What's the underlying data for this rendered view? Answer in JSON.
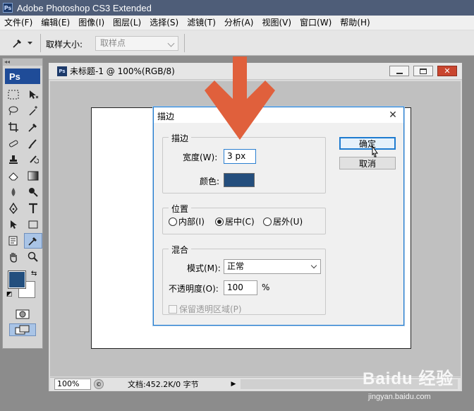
{
  "app": {
    "title": "Adobe Photoshop CS3 Extended",
    "badge": "Ps"
  },
  "menubar": {
    "items": [
      "文件(F)",
      "编辑(E)",
      "图像(I)",
      "图层(L)",
      "选择(S)",
      "滤镜(T)",
      "分析(A)",
      "视图(V)",
      "窗口(W)",
      "帮助(H)"
    ]
  },
  "options_bar": {
    "tool_icon": "eyedropper-icon",
    "sample_size_label": "取样大小:",
    "sample_size_value": "取样点"
  },
  "toolbox": {
    "logo": "Ps",
    "foreground_color": "#234f7e",
    "background_color": "#ffffff"
  },
  "document": {
    "title": "未标题-1 @ 100%(RGB/8)",
    "zoom": "100%",
    "status": "文档:452.2K/0 字节"
  },
  "dialog": {
    "title": "描边",
    "stroke_section": "描边",
    "width_label": "宽度(W):",
    "width_value": "3 px",
    "color_label": "颜色:",
    "stroke_color": "#244e7d",
    "position_section": "位置",
    "position_options": [
      "内部(I)",
      "居中(C)",
      "居外(U)"
    ],
    "position_selected": "居中(C)",
    "blend_section": "混合",
    "mode_label": "模式(M):",
    "mode_value": "正常",
    "opacity_label": "不透明度(O):",
    "opacity_value": "100",
    "opacity_unit": "%",
    "preserve_label": "保留透明区域(P)",
    "ok_label": "确定",
    "cancel_label": "取消"
  },
  "overlay": {
    "arrow_color": "#e0603c"
  },
  "watermark": {
    "brand": "Baidu 经验",
    "url": "jingyan.baidu.com"
  }
}
